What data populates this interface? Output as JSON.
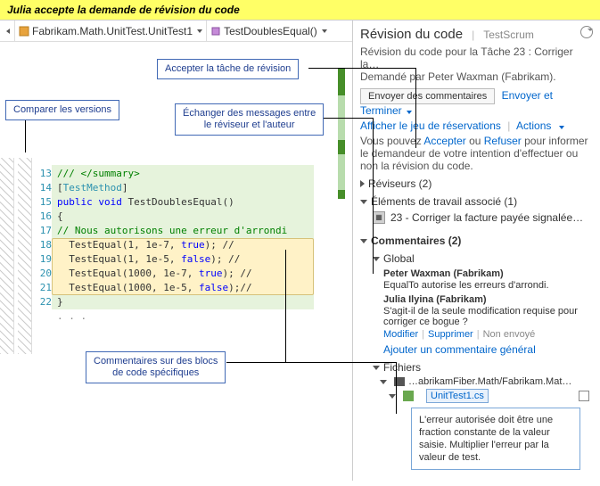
{
  "banner": "Julia accepte la demande de révision du code",
  "toolbar": {
    "file": "Fabrikam.Math.UnitTest.UnitTest1",
    "method": "TestDoublesEqual()"
  },
  "callouts": {
    "compare": "Comparer les versions",
    "accept": "Accepter la tâche de révision",
    "exchange_l1": "Échanger des messages entre",
    "exchange_l2": "le réviseur et l'auteur",
    "blocks_l1": "Commentaires sur des blocs",
    "blocks_l2": "de code spécifiques"
  },
  "code": {
    "lines": [
      "13",
      "14",
      "15",
      "16",
      "17",
      "18",
      "19",
      "20",
      "21",
      "22"
    ],
    "l13": "/// </summary>",
    "l14": "[TestMethod]",
    "l15a": "public",
    "l15b": "void",
    "l15c": "TestDoublesEqual()",
    "l16": "{",
    "l17": "// Nous autorisons une erreur d'arrondi",
    "l18a": "TestEqual(1, 1e-7, ",
    "l18b": "true",
    "l18c": ");  //",
    "l19a": "TestEqual(1, 1e-5, ",
    "l19b": "false",
    "l19c": "); //",
    "l20a": "TestEqual(1000, 1e-7, ",
    "l20b": "true",
    "l20c": ");  //",
    "l21a": "TestEqual(1000, 1e-5, ",
    "l21b": "false",
    "l21c": ");//",
    "l22": "}"
  },
  "panel": {
    "title": "Révision du code",
    "subtitle": "TestScrum",
    "info_l1": "Révision du code pour la Tâche 23 : Corriger la…",
    "info_l2": "Demandé par Peter Waxman (Fabrikam).",
    "send_comments": "Envoyer des commentaires",
    "send_finish": "Envoyer et Terminer",
    "show_shelveset": "Afficher le jeu de réservations",
    "actions": "Actions",
    "accept_text_pre": "Vous pouvez ",
    "accept": "Accepter",
    "or": " ou ",
    "refuse": "Refuser",
    "accept_text_post": " pour informer le demandeur de votre intention d'effectuer ou non la révision du code.",
    "reviewers": "Réviseurs (2)",
    "work_items": "Éléments de travail associé (1)",
    "wi_label": "23 - Corriger la facture payée signalée…",
    "comments_head": "Commentaires (2)",
    "global": "Global",
    "comment1_author": "Peter Waxman (Fabrikam)",
    "comment1_body": "EqualTo autorise les erreurs d'arrondi.",
    "comment2_author": "Julia Ilyina (Fabrikam)",
    "comment2_body": "S'agit-il de la seule modification requise pour corriger ce bogue ?",
    "modify": "Modifier",
    "delete": "Supprimer",
    "not_sent": "Non envoyé",
    "add_general": "Ajouter un commentaire général",
    "files": "Fichiers",
    "folder": "…abrikamFiber.Math/Fabrikam.Mat…",
    "file": "UnitTest1.cs"
  },
  "tooltip": "L'erreur autorisée doit être une fraction constante de la valeur saisie. Multiplier l'erreur par la valeur de test."
}
